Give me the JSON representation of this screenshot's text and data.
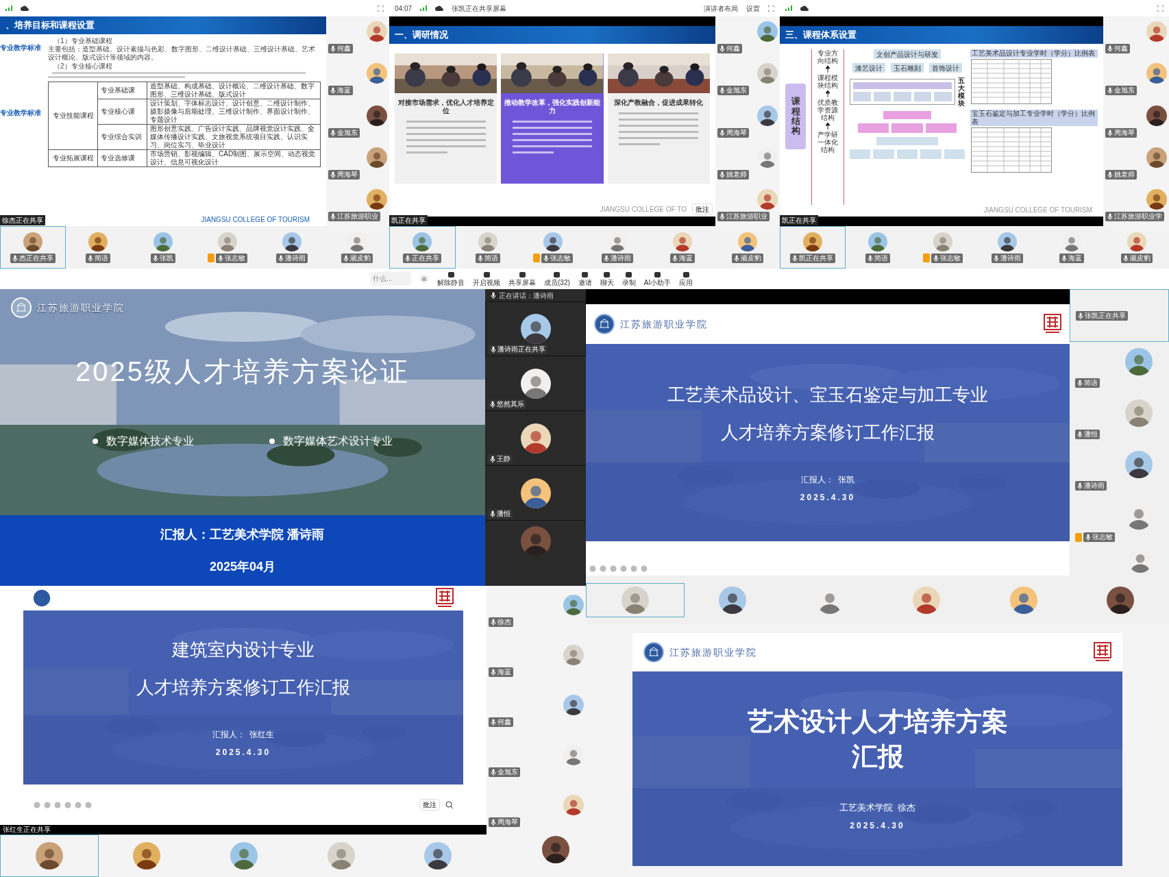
{
  "screen_1": {
    "slide": {
      "title": "、培养目标和课程设置",
      "side_labels": [
        "专业教学标准",
        "专业教学标准"
      ],
      "text": [
        {
          "heading": "（1）专业基础课程",
          "body": "主要包括：造型基础、设计素描与色彩、数字图形、二维设计基础、三维设计基础、艺术设计概论、版式设计等领域的内容。"
        },
        {
          "heading": "（2）专业核心课程"
        }
      ],
      "table": [
        {
          "group": "专业技能课程",
          "rows": [
            {
              "type": "专业基础课",
              "courses": "造型基础、构成基础、设计概论、二维设计基础、数字图形、三维设计基础、版式设计"
            },
            {
              "type": "专业核心课",
              "courses": "设计策划、字体标志设计、设计创意、二维设计制作、摄影摄像与后期处理、三维设计制作、界面设计制作、专题设计"
            },
            {
              "type": "专业综合实训",
              "courses": "图形创意实践、广告设计实践、品牌视觉设计实践、全媒体传播设计实践、文旅视觉系统项目实践、认识实习、岗位实习、毕业设计"
            }
          ]
        },
        {
          "group": "专业拓展课程",
          "rows": [
            {
              "type": "专业选修课",
              "courses": "市场营销、影视编辑、CAD制图、展示空间、动态视觉设计、信息可视化设计"
            }
          ]
        }
      ],
      "footer": "JIANGSU COLLEGE OF TOURISM"
    },
    "sharing_banner": "徐杰正在共享",
    "sidebar": [
      "何鑫",
      "海蓝",
      "金旭东",
      "周海琴",
      "江苏旅游职业"
    ],
    "strip": [
      {
        "name": "杰正在共享",
        "host": false
      },
      {
        "name": "简语",
        "host": false
      },
      {
        "name": "张凯",
        "host": false
      },
      {
        "name": "张志敏",
        "host": true
      },
      {
        "name": "潘诗雨",
        "host": false
      },
      {
        "name": "顽皮豹",
        "host": false
      }
    ]
  },
  "screen_2": {
    "top_bar": {
      "time": "04:07",
      "sharing": "张凯正在共享屏幕",
      "layout": "演讲者布局",
      "settings": "设置"
    },
    "slide": {
      "title": "一、调研情况",
      "cards": [
        {
          "title": "对接市场需求，优化人才培养定位",
          "highlighted": false
        },
        {
          "title": "推动教学改革，强化实践创新能力",
          "highlighted": true
        },
        {
          "title": "深化产教融合，促进成果转化",
          "highlighted": false
        }
      ],
      "footer": "JIANGSU COLLEGE OF TO"
    },
    "annotate_button": "批注",
    "sharing_banner": "凯正在共享",
    "sidebar": [
      "何鑫",
      "金旭东",
      "周海琴",
      "姚老师",
      "江苏旅游职业"
    ],
    "strip": [
      {
        "name": "正在共享",
        "host": false
      },
      {
        "name": "简语",
        "host": false
      },
      {
        "name": "张志敏",
        "host": true
      },
      {
        "name": "潘诗雨",
        "host": false
      },
      {
        "name": "海蓝",
        "host": false
      },
      {
        "name": "顽皮豹",
        "host": false
      }
    ]
  },
  "screen_3": {
    "slide": {
      "title": "三、课程体系设置",
      "structure_label": "课程结构",
      "levels": [
        "专业方向结构",
        "课程模块结构",
        "优质教学资源结构",
        "产学研一体化结构"
      ],
      "top_box": "文创产品设计与研发",
      "direction_boxes": [
        "漆艺设计",
        "玉石雕刻",
        "首饰设计"
      ],
      "module_label": "五大模块",
      "tables": [
        "工艺美术品设计专业学时（学分）比例表",
        "宝玉石鉴定与加工专业学时（学分）比例表"
      ],
      "footer": "JIANGSU COLLEGE OF TOURISM"
    },
    "sharing_banner": "凯正在共享",
    "sidebar": [
      "何鑫",
      "金旭东",
      "周海琴",
      "姚老师",
      "江苏旅游职业学"
    ],
    "strip": [
      {
        "name": "凯正在共享",
        "host": false
      },
      {
        "name": "简语",
        "host": false
      },
      {
        "name": "张志敏",
        "host": true
      },
      {
        "name": "潘诗雨",
        "host": false
      },
      {
        "name": "海蓝",
        "host": false
      },
      {
        "name": "顽皮豹",
        "host": false
      }
    ]
  },
  "toolbar": {
    "search": "什么...",
    "buttons": [
      "解除静音",
      "开启视频",
      "共享屏幕",
      "成员(32)",
      "邀请",
      "聊天",
      "录制",
      "AI小助手",
      "应用"
    ]
  },
  "screen_4": {
    "slide": {
      "school": "江苏旅游职业学院",
      "title": "2025级人才培养方案论证",
      "majors": [
        "数字媒体技术专业",
        "数字媒体艺术设计专业"
      ],
      "reporter": "汇报人：工艺美术学院 潘诗雨",
      "date": "2025年04月"
    },
    "speaking": "正在讲话：潘诗雨",
    "sidebar": [
      "潘诗雨正在共享",
      "悠然其乐",
      "王静",
      "潘恒"
    ]
  },
  "screen_5": {
    "slide": {
      "school": "江苏旅游职业学院",
      "title_lines": [
        "工艺美术品设计、宝玉石鉴定与加工专业",
        "人才培养方案修订工作汇报"
      ],
      "reporter": "汇报人：  张凯",
      "date": "2025.4.30"
    },
    "sidebar": [
      {
        "name": "张凯正在共享",
        "host": false
      },
      {
        "name": "简语",
        "host": false
      },
      {
        "name": "潘恒",
        "host": false
      },
      {
        "name": "潘诗雨",
        "host": false
      },
      {
        "name": "张志敏",
        "host": true
      }
    ]
  },
  "screen_6": {
    "slide": {
      "title_lines": [
        "建筑室内设计专业",
        "人才培养方案修订工作汇报"
      ],
      "reporter": "汇报人：  张红生",
      "date": "2025.4.30"
    },
    "annotate_button": "批注",
    "sharing_banner": "张红生正在共享",
    "sidebar": [
      "徐杰",
      "海蓝",
      "何鑫",
      "金旭东",
      "周海琴"
    ]
  },
  "screen_7": {
    "slide": {
      "school": "江苏旅游职业学院",
      "title_lines": [
        "艺术设计人才培养方案",
        "汇报"
      ],
      "reporter": "工艺美术学院  徐杰",
      "date": "2025.4.30"
    }
  }
}
